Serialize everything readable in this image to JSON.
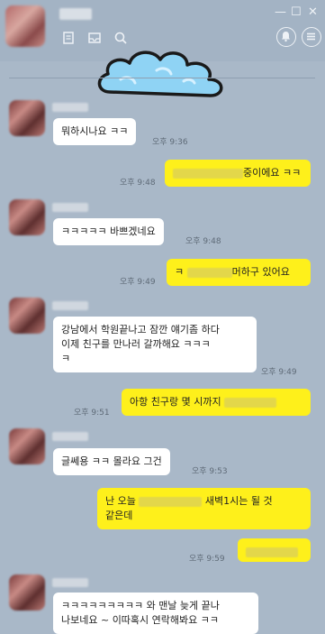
{
  "header": {
    "icons": [
      "memo-icon",
      "inbox-icon",
      "search-icon",
      "bell-icon",
      "menu-icon"
    ],
    "window_controls": [
      "—",
      "☐",
      "✕"
    ]
  },
  "messages": [
    {
      "id": "m1",
      "side": "in",
      "text": "뭐하시나요 ㅋㅋ",
      "time": "오후 9:36"
    },
    {
      "id": "m2",
      "side": "out",
      "text": "중이에요 ㅋㅋ",
      "time": "오후 9:48"
    },
    {
      "id": "m3",
      "side": "in",
      "text": "ㅋㅋㅋㅋㅋ 바쁘겠네요",
      "time": "오후 9:48"
    },
    {
      "id": "m4",
      "side": "out",
      "text_pre": "ㅋ",
      "text": "머하구 있어요",
      "time": "오후 9:49"
    },
    {
      "id": "m5",
      "side": "in",
      "line1": "강남에서 학원끝나고 잠깐 얘기좀 하다",
      "line2": "이제 친구를 만나러 갈까해요 ㅋㅋㅋ",
      "line3": "ㅋ",
      "time": "오후 9:49"
    },
    {
      "id": "m6",
      "side": "out",
      "text": "아항 친구랑 몇 시까지",
      "time": "오후 9:51"
    },
    {
      "id": "m7",
      "side": "in",
      "text": "글쎄용 ㅋㅋ 몰라요 그건",
      "time": "오후 9:53"
    },
    {
      "id": "m8",
      "side": "out",
      "line1_pre": "난 오늘",
      "line1_post": "새벽1시는 될 것",
      "line2": "같은데",
      "time": "오후 9:59"
    },
    {
      "id": "m9",
      "side": "out",
      "time": ""
    },
    {
      "id": "m10",
      "side": "in",
      "line1": "ㅋㅋㅋㅋㅋㅋㅋㅋㅋ 와 맨날 늦게 끝나",
      "line2": "나보네요 ~ 이따혹시 연락해봐요 ㅋㅋ"
    }
  ],
  "colors": {
    "background": "#a9b8c8",
    "incoming": "#ffffff",
    "outgoing": "#fef01b"
  }
}
